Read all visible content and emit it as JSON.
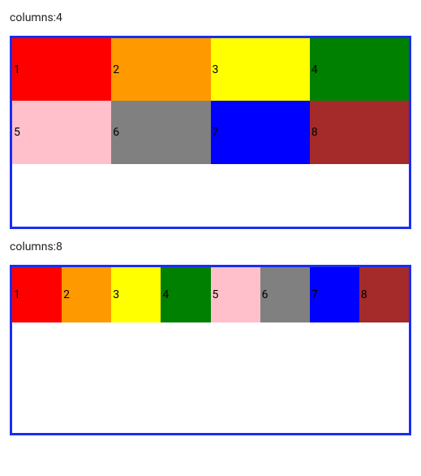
{
  "examples": [
    {
      "label": "columns:4",
      "columns": 4,
      "rows": 3,
      "cells": [
        {
          "label": "1",
          "color": "#ff0000"
        },
        {
          "label": "2",
          "color": "#ff9900"
        },
        {
          "label": "3",
          "color": "#ffff00"
        },
        {
          "label": "4",
          "color": "#008000"
        },
        {
          "label": "5",
          "color": "#ffc0cb"
        },
        {
          "label": "6",
          "color": "#808080"
        },
        {
          "label": "7",
          "color": "#0000ff"
        },
        {
          "label": "8",
          "color": "#a52a2a"
        }
      ]
    },
    {
      "label": "columns:8",
      "columns": 8,
      "rows": 3,
      "cells": [
        {
          "label": "1",
          "color": "#ff0000"
        },
        {
          "label": "2",
          "color": "#ff9900"
        },
        {
          "label": "3",
          "color": "#ffff00"
        },
        {
          "label": "4",
          "color": "#008000"
        },
        {
          "label": "5",
          "color": "#ffc0cb"
        },
        {
          "label": "6",
          "color": "#808080"
        },
        {
          "label": "7",
          "color": "#0000ff"
        },
        {
          "label": "8",
          "color": "#a52a2a"
        }
      ]
    }
  ]
}
